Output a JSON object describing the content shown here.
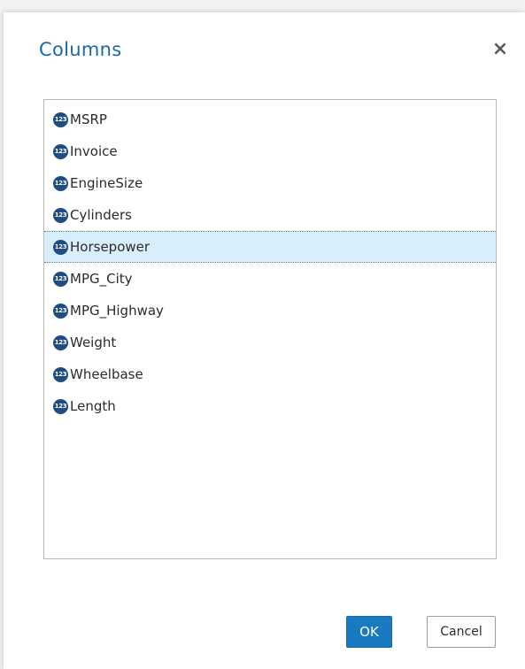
{
  "dialog": {
    "title": "Columns",
    "close_label": "×"
  },
  "icons": {
    "numeric": "123"
  },
  "columns": [
    {
      "label": "MSRP",
      "icon": "numeric-icon",
      "selected": false
    },
    {
      "label": "Invoice",
      "icon": "numeric-icon",
      "selected": false
    },
    {
      "label": "EngineSize",
      "icon": "numeric-icon",
      "selected": false
    },
    {
      "label": "Cylinders",
      "icon": "numeric-icon",
      "selected": false
    },
    {
      "label": "Horsepower",
      "icon": "numeric-icon",
      "selected": true
    },
    {
      "label": "MPG_City",
      "icon": "numeric-icon",
      "selected": false
    },
    {
      "label": "MPG_Highway",
      "icon": "numeric-icon",
      "selected": false
    },
    {
      "label": "Weight",
      "icon": "numeric-icon",
      "selected": false
    },
    {
      "label": "Wheelbase",
      "icon": "numeric-icon",
      "selected": false
    },
    {
      "label": "Length",
      "icon": "numeric-icon",
      "selected": false
    }
  ],
  "buttons": {
    "ok_label": "OK",
    "cancel_label": "Cancel"
  },
  "colors": {
    "title": "#1a6aa5",
    "selection_bg": "#d8eefb",
    "numeric_icon": "#1f4d82",
    "primary_button": "#1a7ac1"
  }
}
